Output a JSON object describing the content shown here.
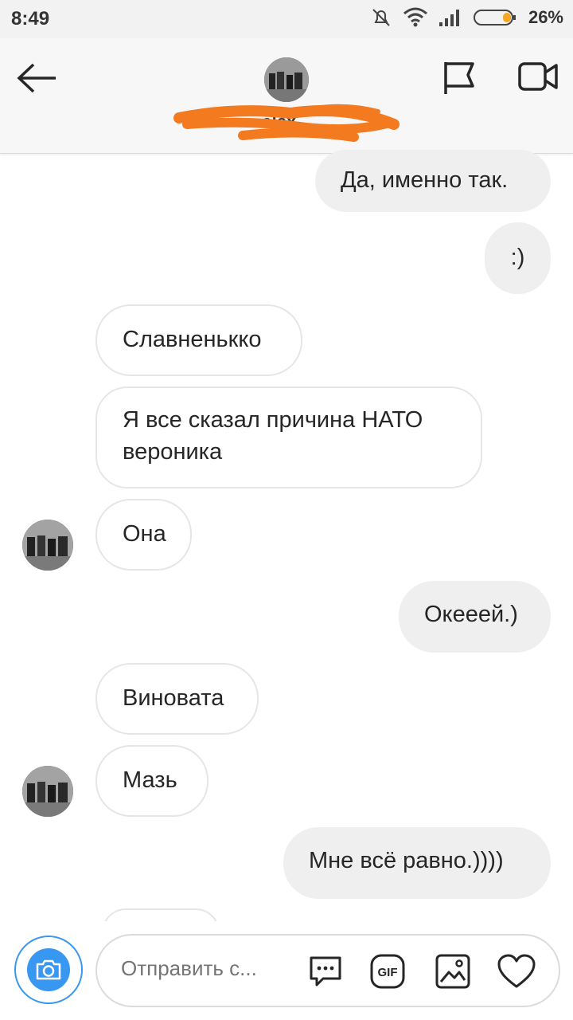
{
  "status_bar": {
    "time": "8:49",
    "battery": "26%"
  },
  "header": {
    "name": "alex..."
  },
  "messages": [
    {
      "text": "Да, именно так.",
      "dir": "out"
    },
    {
      "text": ":)",
      "dir": "out"
    },
    {
      "text": "Славненькко",
      "dir": "in"
    },
    {
      "line1": "Я все сказал причина НАТО",
      "line2": "вероника",
      "dir": "in"
    },
    {
      "text": "Она",
      "dir": "in"
    },
    {
      "text": "Океeей.)",
      "dir": "out"
    },
    {
      "text": "Виновата",
      "dir": "in"
    },
    {
      "text": "Мазь",
      "dir": "in"
    },
    {
      "text": "Мне всё равно.))))",
      "dir": "out"
    }
  ],
  "composer": {
    "placeholder": "Отправить с...",
    "icons": [
      "camera-icon",
      "sticker-icon",
      "gif-icon",
      "gallery-icon",
      "heart-icon"
    ],
    "gif_label": "GIF"
  },
  "colors": {
    "accent": "#3897f0",
    "outgoing_bubble": "#efefef",
    "scribble": "#f47a20"
  }
}
